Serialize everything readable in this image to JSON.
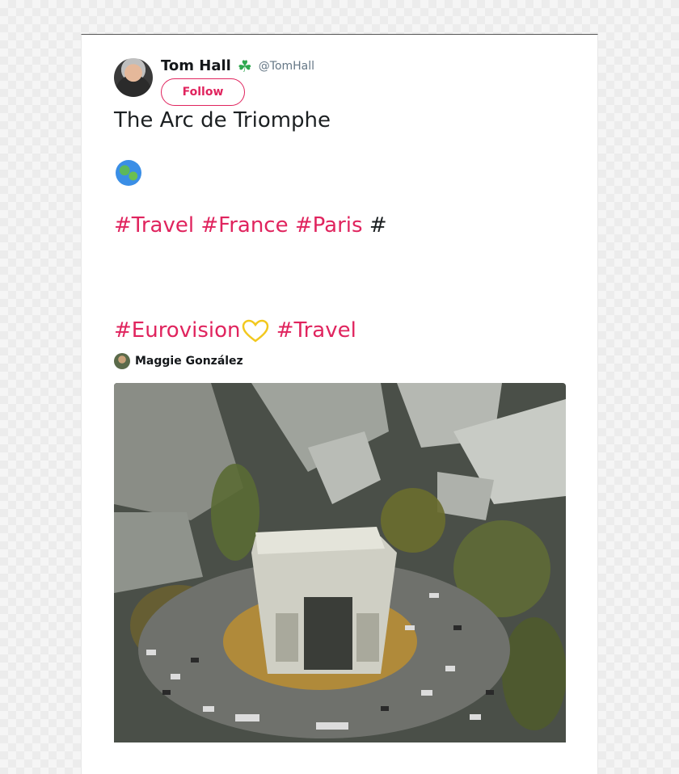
{
  "tweet": {
    "author_name": "Tom Hall",
    "author_handle": "@TomHall",
    "follow_label": "Follow",
    "line1": "The Arc de Triomphe",
    "hashtags_line1": [
      "#Travel",
      "#France",
      "#Paris"
    ],
    "trailing_hash": "#",
    "hashtags_line2": [
      "#Eurovision",
      "#Travel"
    ]
  },
  "quoted": {
    "author_name": "Maggie González"
  },
  "colors": {
    "hashtag": "#e0245e",
    "follow": "#e0245e",
    "handle": "#657786"
  },
  "icons": {
    "clover": "shamrock-icon",
    "globe": "globe-europe-africa-icon",
    "heart": "yellow-heart-icon"
  }
}
